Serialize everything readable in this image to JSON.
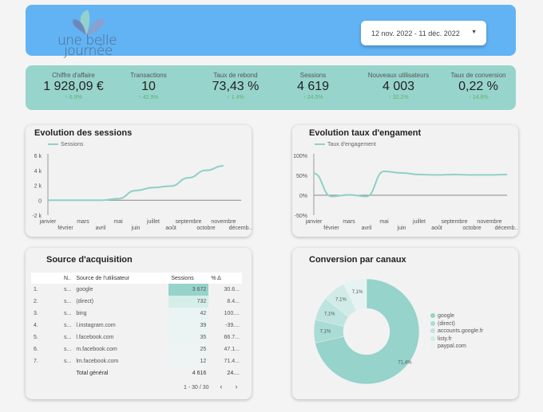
{
  "header": {
    "logo_text": [
      "une belle",
      "journée"
    ],
    "date_range": "12 nov. 2022 - 11 déc. 2022"
  },
  "kpis": [
    {
      "label": "Chiffre d'affaire",
      "value": "1 928,09 €",
      "delta": "↑ 6.9%"
    },
    {
      "label": "Transactions",
      "value": "10",
      "delta": "↑ 42.9%"
    },
    {
      "label": "Taux de rebond",
      "value": "73,43 %",
      "delta": "↑ 1.4%"
    },
    {
      "label": "Sessions",
      "value": "4 619",
      "delta": "↑ 24.5%"
    },
    {
      "label": "Nouveaux utilisateurs",
      "value": "4 003",
      "delta": "↑ 32.2%"
    },
    {
      "label": "Taux de conversion",
      "value": "0,22 %",
      "delta": "↑ 14.8%"
    }
  ],
  "colors": {
    "header": "#62b3f4",
    "kpi_band": "#97d4cc",
    "accent": "#8fd0c7",
    "positive": "#5bb56a"
  },
  "chart_data": [
    {
      "type": "line",
      "title": "Evolution des sessions",
      "series": [
        {
          "name": "Sessions",
          "values": [
            0,
            0,
            0,
            0,
            200,
            1300,
            1700,
            1900,
            3000,
            4000,
            4600,
            null
          ]
        }
      ],
      "categories": [
        "janvier",
        "février",
        "mars",
        "avril",
        "mai",
        "juin",
        "juillet",
        "août",
        "septembre",
        "octobre",
        "novembre",
        "décemb..."
      ],
      "yticks": [
        "6 k",
        "4 k",
        "2 k",
        "0",
        "-2 k"
      ],
      "ylim": [
        -2000,
        6000
      ],
      "legend": "top-left"
    },
    {
      "type": "line",
      "title": "Evolution taux d'engament",
      "series": [
        {
          "name": "Taux d'engagement",
          "values": [
            55,
            -3,
            1,
            -3,
            60,
            56,
            52,
            51,
            52,
            51,
            51,
            52
          ]
        }
      ],
      "categories": [
        "janvier",
        "février",
        "mars",
        "avril",
        "mai",
        "juin",
        "juillet",
        "août",
        "septembre",
        "octobre",
        "novembre",
        "décemb..."
      ],
      "yticks": [
        "100%",
        "50%",
        "0%",
        "-50%"
      ],
      "ylim": [
        -50,
        100
      ],
      "legend": "top-left"
    },
    {
      "type": "pie",
      "title": "Conversion par canaux",
      "labels": [
        "google",
        "(direct)",
        "accounts.google.fr",
        "listy.fr",
        "paypal.com"
      ],
      "values": [
        71.4,
        7.1,
        7.1,
        7.1,
        7.1
      ],
      "value_labels": [
        "71,4%",
        "7,1%",
        "7,1%",
        "7,1%",
        "7,1%"
      ],
      "colors": [
        "#95d3cb",
        "#a9dcd5",
        "#bde4de",
        "#d1ece8",
        "#e5f4f2"
      ],
      "legend": "right"
    }
  ],
  "table": {
    "title": "Source d'acquisition",
    "headers": [
      "",
      "N..",
      "Source de l'utilisateur",
      "Sessions",
      "% Δ"
    ],
    "rows": [
      [
        "1.",
        "s...",
        "google",
        "3 672",
        "30.6..."
      ],
      [
        "2.",
        "s...",
        "(direct)",
        "732",
        "8.4..."
      ],
      [
        "3.",
        "s...",
        "bing",
        "42",
        "100...."
      ],
      [
        "4.",
        "s...",
        "l.instagram.com",
        "39",
        "-39...."
      ],
      [
        "5.",
        "s...",
        "l.facebook.com",
        "35",
        "66.7..."
      ],
      [
        "6.",
        "s...",
        "m.facebook.com",
        "25",
        "47.1..."
      ],
      [
        "7.",
        "s...",
        "lm.facebook.com",
        "12",
        "71.4..."
      ]
    ],
    "total": {
      "label": "Total général",
      "sessions": "4 616",
      "delta": "24...."
    },
    "pagination": "1 - 30 / 30"
  }
}
